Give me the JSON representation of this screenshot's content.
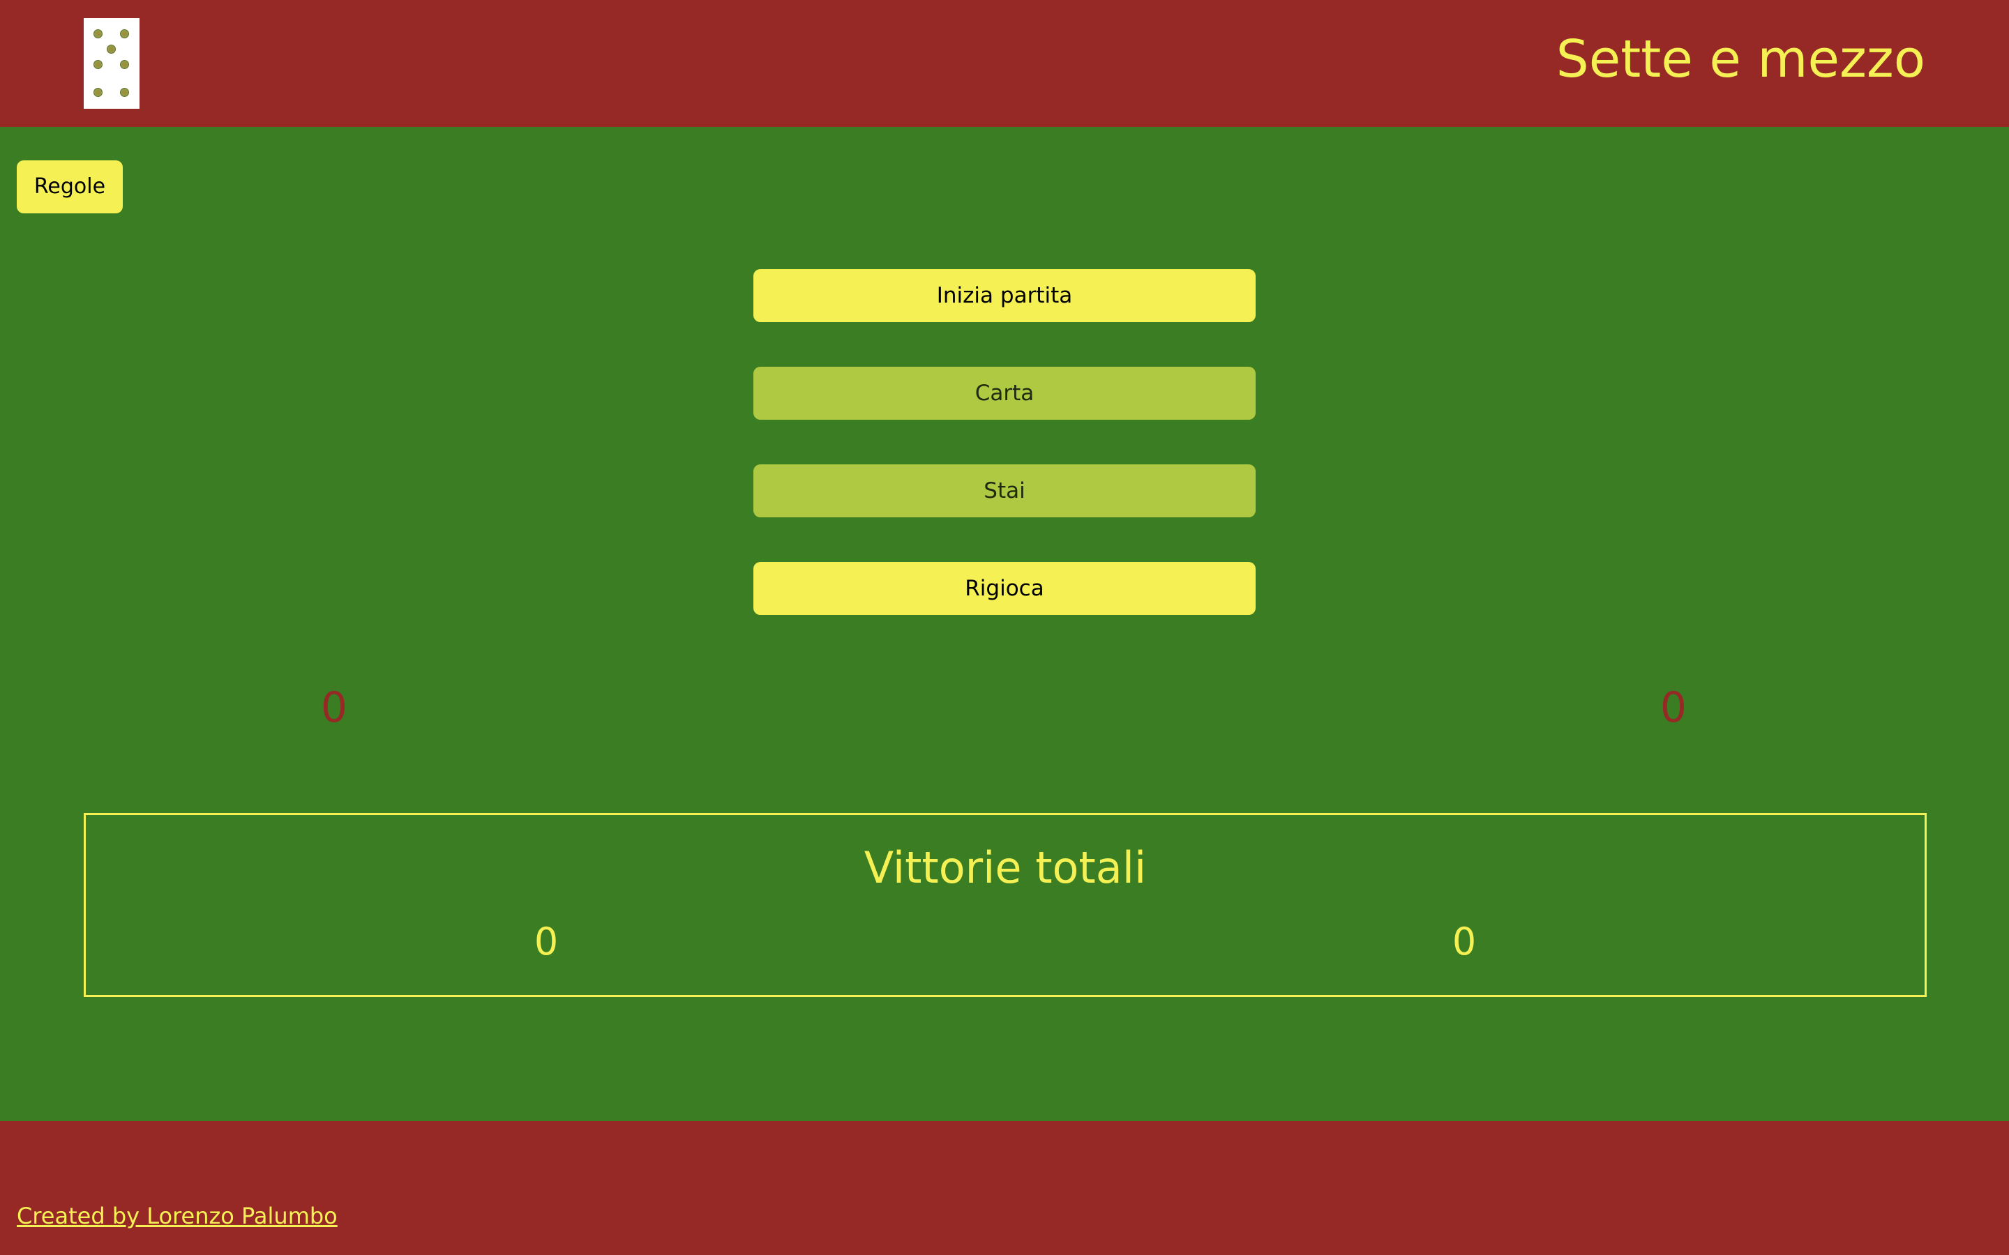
{
  "header": {
    "title": "Sette e mezzo",
    "logo_icon": "playing-card-icon"
  },
  "rules_button": {
    "label": "Regole"
  },
  "actions": {
    "start": {
      "label": "Inizia partita",
      "enabled": true
    },
    "card": {
      "label": "Carta",
      "enabled": false
    },
    "stay": {
      "label": "Stai",
      "enabled": false
    },
    "replay": {
      "label": "Rigioca",
      "enabled": true
    }
  },
  "scores": {
    "player": "0",
    "dealer": "0"
  },
  "victories": {
    "title": "Vittorie totali",
    "player": "0",
    "dealer": "0"
  },
  "footer": {
    "credit": "Created by Lorenzo Palumbo"
  },
  "colors": {
    "table_green": "#3a7d23",
    "banner_red": "#962926",
    "accent_yellow": "#f5f154",
    "disabled_button": "#b0c942"
  }
}
